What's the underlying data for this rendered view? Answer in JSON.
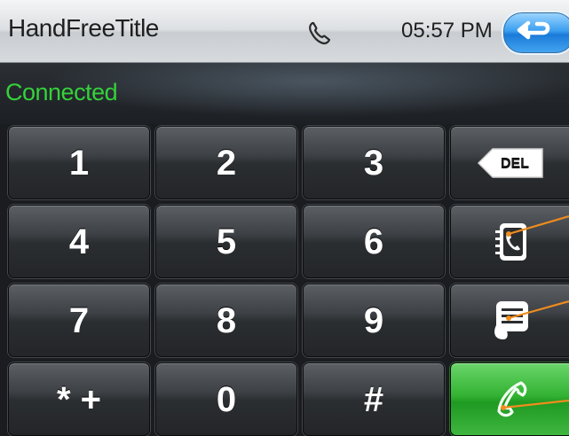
{
  "window": {
    "title": "HandFreeTitle"
  },
  "header": {
    "time": "05:57 PM",
    "phone_icon": "phone-icon",
    "back_icon": "back-arrow-icon"
  },
  "status": {
    "text": "Connected",
    "color": "#35d13a"
  },
  "keypad": {
    "keys": [
      "1",
      "2",
      "3",
      "4",
      "5",
      "6",
      "7",
      "8",
      "9",
      "* +",
      "0",
      "#"
    ],
    "del_label": "DEL",
    "side_icons": [
      "delete-icon",
      "contacts-icon",
      "message-icon",
      "call-icon"
    ]
  },
  "colors": {
    "accent": "#3b9ff0",
    "call": "#33b233",
    "callout": "#f08c1e"
  }
}
